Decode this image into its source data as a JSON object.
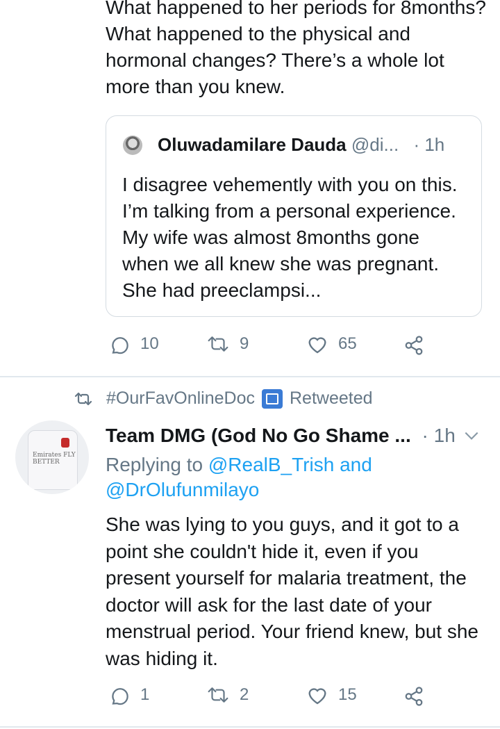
{
  "tweet1": {
    "text": "What happened to her periods for 8months? What happened to the physical and hormonal changes? There’s a whole lot more than you knew.",
    "quote": {
      "author_name": "Oluwadamilare Dauda",
      "author_handle": "@di...",
      "time": "· 1h",
      "text": "I disagree vehemently with you on this. I’m talking from a personal experience. My wife was almost 8months gone when we all knew she was pregnant. She had preeclampsi..."
    },
    "actions": {
      "replies": "10",
      "retweets": "9",
      "likes": "65"
    }
  },
  "retweet_context": {
    "user": "#OurFavOnlineDoc",
    "label": "Retweeted"
  },
  "tweet2": {
    "author_name": "Team DMG (God No Go Shame ...",
    "time": "· 1h",
    "replying_prefix": "Replying to",
    "reply_user_1": "@RealB_Trish",
    "reply_and": "and",
    "reply_user_2": "@DrOlufunmilayo",
    "text": "She was lying to you guys, and it got to a point she couldn't hide it, even if you present yourself for malaria treatment, the doctor will ask for the last date of your menstrual period. Your friend knew, but she was hiding it.",
    "avatar_text": "Emirates FLY BETTER",
    "actions": {
      "replies": "1",
      "retweets": "2",
      "likes": "15"
    }
  },
  "colors": {
    "text": "#14171a",
    "secondary": "#657786",
    "link": "#1da1f2",
    "border": "#e1e8ed"
  }
}
